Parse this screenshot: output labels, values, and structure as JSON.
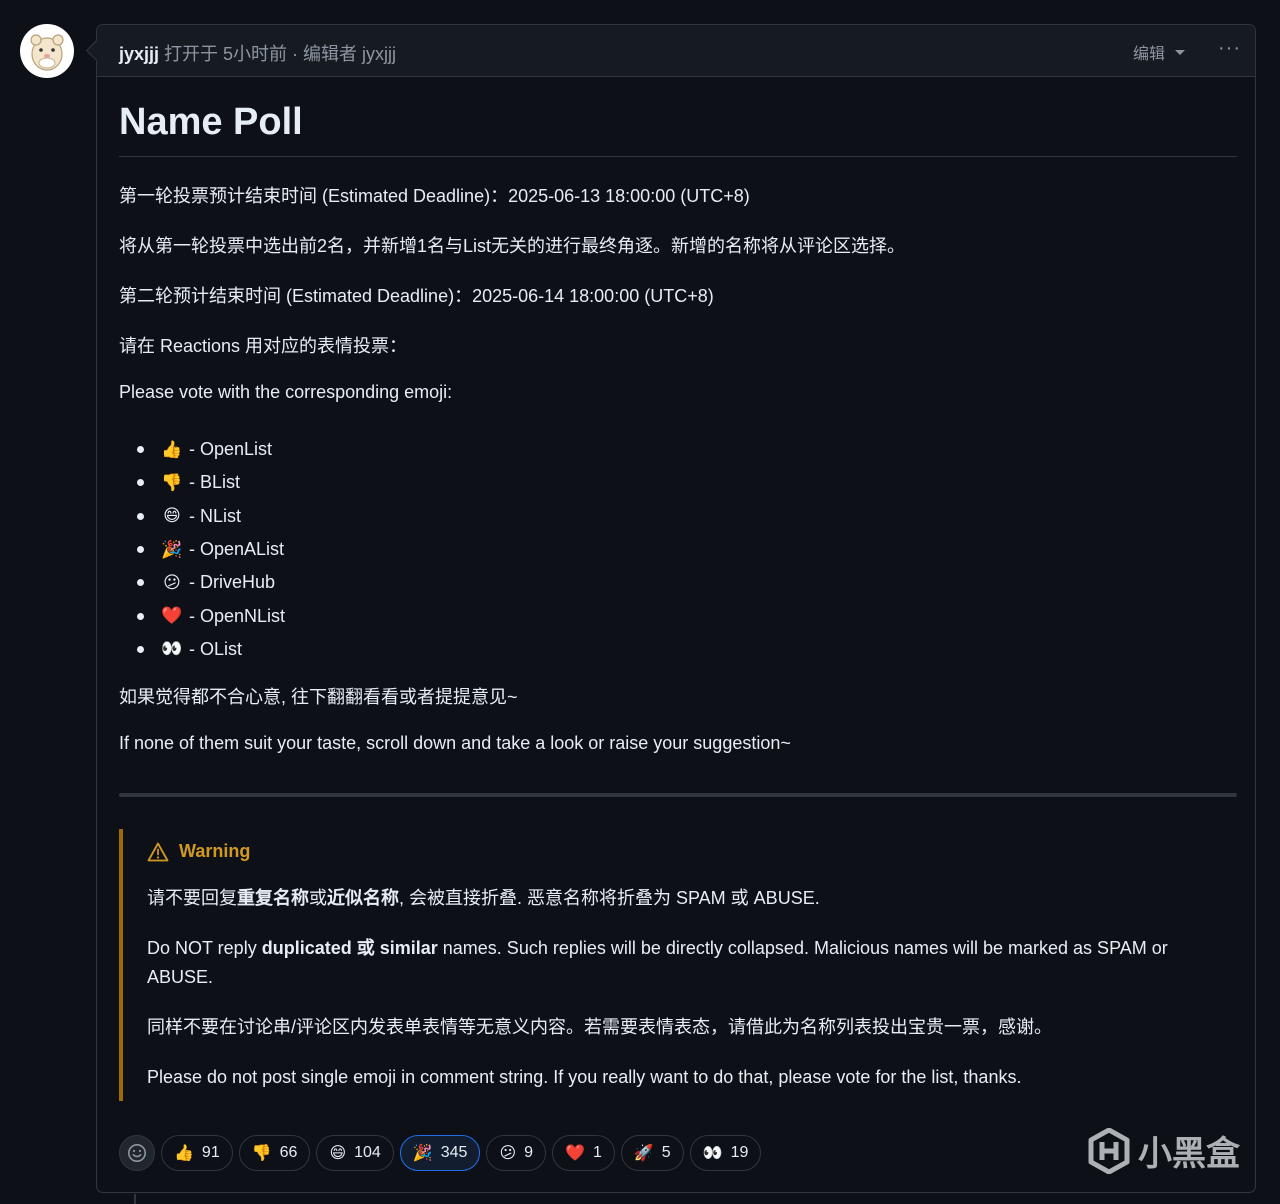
{
  "header": {
    "author": "jyxjjj",
    "meta": "打开于 5小时前 · 编辑者 jyxjjj",
    "edit_label": "编辑",
    "more_label": "···"
  },
  "body": {
    "title": "Name Poll",
    "p1": "第一轮投票预计结束时间 (Estimated Deadline)：2025-06-13 18:00:00 (UTC+8)",
    "p2": "将从第一轮投票中选出前2名，并新增1名与List无关的进行最终角逐。新增的名称将从评论区选择。",
    "p3": "第二轮预计结束时间 (Estimated Deadline)：2025-06-14 18:00:00 (UTC+8)",
    "p4": "请在 Reactions 用对应的表情投票：",
    "p5": "Please vote with the corresponding emoji:",
    "options": [
      {
        "emoji": "👍",
        "icon": "thumbs-up-icon",
        "label": "- OpenList"
      },
      {
        "emoji": "👎",
        "icon": "thumbs-down-icon",
        "label": "- BList"
      },
      {
        "emoji": "😄",
        "icon": "laugh-icon",
        "label": "- NList"
      },
      {
        "emoji": "🎉",
        "icon": "hooray-icon",
        "label": "- OpenAList"
      },
      {
        "emoji": "😕",
        "icon": "confused-icon",
        "label": "- DriveHub"
      },
      {
        "emoji": "❤️",
        "icon": "heart-icon",
        "label": "- OpenNList"
      },
      {
        "emoji": "👀",
        "icon": "eyes-icon",
        "label": "- OList"
      }
    ],
    "p6": "如果觉得都不合心意, 往下翻翻看看或者提提意见~",
    "p7": "If none of them suit your taste, scroll down and take a look or raise your suggestion~"
  },
  "warning": {
    "title": "Warning",
    "cn1_pre": "请不要回复",
    "cn1_b1": "重复名称",
    "cn1_mid": "或",
    "cn1_b2": "近似名称",
    "cn1_post": ", 会被直接折叠. 恶意名称将折叠为 SPAM 或 ABUSE.",
    "en1_pre": "Do NOT reply ",
    "en1_b1": "duplicated",
    "en1_mid": " 或 ",
    "en1_b2": "similar",
    "en1_post": " names. Such replies will be directly collapsed. Malicious names will be marked as SPAM or ABUSE.",
    "cn2": "同样不要在讨论串/评论区内发表单表情等无意义内容。若需要表情表态，请借此为名称列表投出宝贵一票，感谢。",
    "en2": "Please do not post single emoji in comment string. If you really want to do that, please vote for the list, thanks."
  },
  "reactions": [
    {
      "emoji": "👍",
      "icon": "thumbs-up-icon",
      "count": "91",
      "active": false
    },
    {
      "emoji": "👎",
      "icon": "thumbs-down-icon",
      "count": "66",
      "active": false
    },
    {
      "emoji": "😄",
      "icon": "laugh-icon",
      "count": "104",
      "active": false
    },
    {
      "emoji": "🎉",
      "icon": "hooray-icon",
      "count": "345",
      "active": true
    },
    {
      "emoji": "😕",
      "icon": "confused-icon",
      "count": "9",
      "active": false
    },
    {
      "emoji": "❤️",
      "icon": "heart-icon",
      "count": "1",
      "active": false
    },
    {
      "emoji": "🚀",
      "icon": "rocket-icon",
      "count": "5",
      "active": false
    },
    {
      "emoji": "👀",
      "icon": "eyes-icon",
      "count": "19",
      "active": false
    }
  ],
  "watermark": {
    "text": "小黑盒"
  },
  "colors": {
    "accent_active": "#1f6feb",
    "warning": "#d29922",
    "text": "#e6edf3",
    "muted": "#8d96a0"
  }
}
